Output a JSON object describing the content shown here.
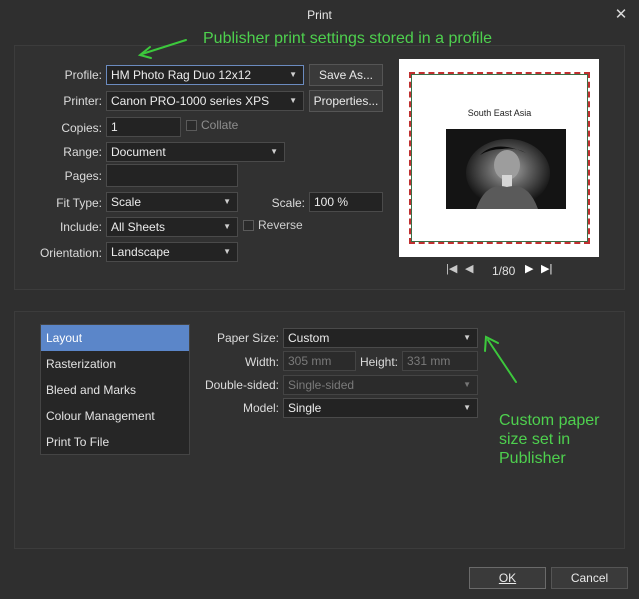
{
  "window": {
    "title": "Print",
    "close_glyph": "✕"
  },
  "annotations": {
    "top": "Publisher print settings stored in a profile",
    "bottom": [
      "Custom paper",
      "size set in",
      "Publisher"
    ],
    "arrow_color": "#3cc83c"
  },
  "form": {
    "profile": {
      "label": "Profile:",
      "value": "HM Photo Rag Duo 12x12",
      "button": "Save As..."
    },
    "printer": {
      "label": "Printer:",
      "value": "Canon PRO-1000 series XPS",
      "button": "Properties..."
    },
    "copies": {
      "label": "Copies:",
      "value": "1",
      "collate_label": "Collate",
      "collate_checked": false
    },
    "range": {
      "label": "Range:",
      "value": "Document"
    },
    "pages": {
      "label": "Pages:",
      "value": ""
    },
    "fit_type": {
      "label": "Fit Type:",
      "value": "Scale"
    },
    "scale": {
      "label": "Scale:",
      "value": "100 %"
    },
    "include": {
      "label": "Include:",
      "value": "All Sheets",
      "reverse_label": "Reverse",
      "reverse_checked": false
    },
    "orientation": {
      "label": "Orientation:",
      "value": "Landscape"
    }
  },
  "preview": {
    "heading": "South East Asia",
    "page_indicator": "1/80",
    "nav_icons": [
      "first-page-icon",
      "prev-page-icon",
      "next-page-icon",
      "last-page-icon"
    ]
  },
  "sections": {
    "items": [
      "Layout",
      "Rasterization",
      "Bleed and Marks",
      "Colour Management",
      "Print To File"
    ],
    "selected": "Layout",
    "selected_color": "#5b86c9"
  },
  "layout_panel": {
    "paper_size": {
      "label": "Paper Size:",
      "value": "Custom"
    },
    "width": {
      "label": "Width:",
      "value": "305 mm"
    },
    "height": {
      "label": "Height:",
      "value": "331 mm"
    },
    "double_sided": {
      "label": "Double-sided:",
      "value": "Single-sided"
    },
    "model": {
      "label": "Model:",
      "value": "Single"
    }
  },
  "footer": {
    "ok": "OK",
    "cancel": "Cancel"
  }
}
